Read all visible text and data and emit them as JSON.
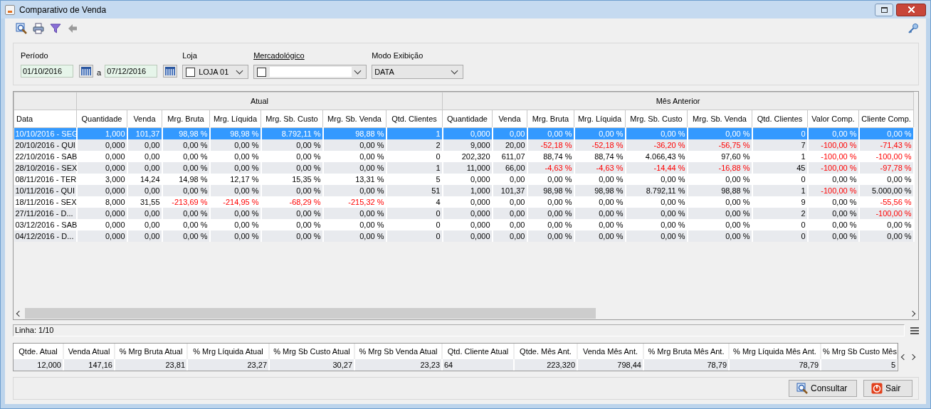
{
  "window": {
    "title": "Comparativo de Venda"
  },
  "filters": {
    "periodo_label": "Período",
    "date_from": "01/10/2016",
    "separator": "a",
    "date_to": "07/12/2016",
    "loja_label": "Loja",
    "loja_value": "LOJA 01",
    "loja_checked": false,
    "mercadologico_label": "Mercadológico",
    "mercadologico_checked": false,
    "modo_label": "Modo Exibição",
    "modo_value": "DATA"
  },
  "table": {
    "groups": [
      {
        "label": "Atual"
      },
      {
        "label": "Mês Anterior"
      }
    ],
    "columns": [
      "Data",
      "Quantidade",
      "Venda",
      "Mrg. Bruta",
      "Mrg. Líquida",
      "Mrg. Sb. Custo",
      "Mrg. Sb. Venda",
      "Qtd. Clientes",
      "Quantidade",
      "Venda",
      "Mrg. Bruta",
      "Mrg. Líquida",
      "Mrg. Sb. Custo",
      "Mrg. Sb. Venda",
      "Qtd. Clientes",
      "Valor Comp.",
      "Cliente Comp."
    ],
    "rows": [
      {
        "selected": true,
        "negative": [
          false,
          false,
          false,
          false,
          false,
          false,
          false,
          false,
          false,
          false,
          false,
          false,
          false,
          false,
          false,
          false,
          false
        ],
        "cells": [
          "10/10/2016 - SEG",
          "1,000",
          "101,37",
          "98,98 %",
          "98,98 %",
          "8.792,11 %",
          "98,88 %",
          "1",
          "0,000",
          "0,00",
          "0,00 %",
          "0,00 %",
          "0,00 %",
          "0,00 %",
          "0",
          "0,00 %",
          "0,00 %"
        ]
      },
      {
        "selected": false,
        "negative": [
          false,
          false,
          false,
          false,
          false,
          false,
          false,
          false,
          false,
          false,
          true,
          true,
          true,
          true,
          false,
          true,
          true
        ],
        "cells": [
          "20/10/2016 - QUI",
          "0,000",
          "0,00",
          "0,00 %",
          "0,00 %",
          "0,00 %",
          "0,00 %",
          "2",
          "9,000",
          "20,00",
          "-52,18 %",
          "-52,18 %",
          "-36,20 %",
          "-56,75 %",
          "7",
          "-100,00 %",
          "-71,43 %"
        ]
      },
      {
        "selected": false,
        "negative": [
          false,
          false,
          false,
          false,
          false,
          false,
          false,
          false,
          false,
          false,
          false,
          false,
          false,
          false,
          false,
          true,
          true
        ],
        "cells": [
          "22/10/2016 - SAB",
          "0,000",
          "0,00",
          "0,00 %",
          "0,00 %",
          "0,00 %",
          "0,00 %",
          "0",
          "202,320",
          "611,07",
          "88,74 %",
          "88,74 %",
          "4.066,43 %",
          "97,60 %",
          "1",
          "-100,00 %",
          "-100,00 %"
        ]
      },
      {
        "selected": false,
        "negative": [
          false,
          false,
          false,
          false,
          false,
          false,
          false,
          false,
          false,
          false,
          true,
          true,
          true,
          true,
          false,
          true,
          true
        ],
        "cells": [
          "28/10/2016 - SEX",
          "0,000",
          "0,00",
          "0,00 %",
          "0,00 %",
          "0,00 %",
          "0,00 %",
          "1",
          "11,000",
          "66,00",
          "-4,63 %",
          "-4,63 %",
          "-14,44 %",
          "-16,88 %",
          "45",
          "-100,00 %",
          "-97,78 %"
        ]
      },
      {
        "selected": false,
        "negative": [
          false,
          false,
          false,
          false,
          false,
          false,
          false,
          false,
          false,
          false,
          false,
          false,
          false,
          false,
          false,
          false,
          false
        ],
        "cells": [
          "08/11/2016 - TER",
          "3,000",
          "14,24",
          "14,98 %",
          "12,17 %",
          "15,35 %",
          "13,31 %",
          "5",
          "0,000",
          "0,00",
          "0,00 %",
          "0,00 %",
          "0,00 %",
          "0,00 %",
          "0",
          "0,00 %",
          "0,00 %"
        ]
      },
      {
        "selected": false,
        "negative": [
          false,
          false,
          false,
          false,
          false,
          false,
          false,
          false,
          false,
          false,
          false,
          false,
          false,
          false,
          false,
          true,
          false
        ],
        "cells": [
          "10/11/2016 - QUI",
          "0,000",
          "0,00",
          "0,00 %",
          "0,00 %",
          "0,00 %",
          "0,00 %",
          "51",
          "1,000",
          "101,37",
          "98,98 %",
          "98,98 %",
          "8.792,11 %",
          "98,88 %",
          "1",
          "-100,00 %",
          "5.000,00 %"
        ]
      },
      {
        "selected": false,
        "negative": [
          false,
          false,
          false,
          true,
          true,
          true,
          true,
          false,
          false,
          false,
          false,
          false,
          false,
          false,
          false,
          false,
          true
        ],
        "cells": [
          "18/11/2016 - SEX",
          "8,000",
          "31,55",
          "-213,69 %",
          "-214,95 %",
          "-68,29 %",
          "-215,32 %",
          "4",
          "0,000",
          "0,00",
          "0,00 %",
          "0,00 %",
          "0,00 %",
          "0,00 %",
          "9",
          "0,00 %",
          "-55,56 %"
        ]
      },
      {
        "selected": false,
        "negative": [
          false,
          false,
          false,
          false,
          false,
          false,
          false,
          false,
          false,
          false,
          false,
          false,
          false,
          false,
          false,
          false,
          true
        ],
        "cells": [
          "27/11/2016 - D...",
          "0,000",
          "0,00",
          "0,00 %",
          "0,00 %",
          "0,00 %",
          "0,00 %",
          "0",
          "0,000",
          "0,00",
          "0,00 %",
          "0,00 %",
          "0,00 %",
          "0,00 %",
          "2",
          "0,00 %",
          "-100,00 %"
        ]
      },
      {
        "selected": false,
        "negative": [
          false,
          false,
          false,
          false,
          false,
          false,
          false,
          false,
          false,
          false,
          false,
          false,
          false,
          false,
          false,
          false,
          false
        ],
        "cells": [
          "03/12/2016 - SAB",
          "0,000",
          "0,00",
          "0,00 %",
          "0,00 %",
          "0,00 %",
          "0,00 %",
          "0",
          "0,000",
          "0,00",
          "0,00 %",
          "0,00 %",
          "0,00 %",
          "0,00 %",
          "0",
          "0,00 %",
          "0,00 %"
        ]
      },
      {
        "selected": false,
        "negative": [
          false,
          false,
          false,
          false,
          false,
          false,
          false,
          false,
          false,
          false,
          false,
          false,
          false,
          false,
          false,
          false,
          false
        ],
        "cells": [
          "04/12/2016 - D...",
          "0,000",
          "0,00",
          "0,00 %",
          "0,00 %",
          "0,00 %",
          "0,00 %",
          "0",
          "0,000",
          "0,00",
          "0,00 %",
          "0,00 %",
          "0,00 %",
          "0,00 %",
          "0",
          "0,00 %",
          "0,00 %"
        ]
      }
    ]
  },
  "status_bar": {
    "text": "Linha: 1/10"
  },
  "summary": {
    "columns": [
      "Qtde. Atual",
      "Venda Atual",
      "% Mrg Bruta Atual",
      "% Mrg Líquida Atual",
      "% Mrg Sb Custo Atual",
      "% Mrg Sb Venda Atual",
      "Qtd. Cliente Atual",
      "Qtde. Mês Ant.",
      "Venda Mês Ant.",
      "% Mrg Bruta Mês Ant.",
      "% Mrg Líquida Mês Ant.",
      "% Mrg Sb Custo Mês"
    ],
    "values": [
      "12,000",
      "147,16",
      "23,81",
      "23,27",
      "30,27",
      "23,23",
      "64",
      "223,320",
      "798,44",
      "78,79",
      "78,79",
      "5"
    ]
  },
  "buttons": [
    "Consultar",
    "Sair"
  ]
}
